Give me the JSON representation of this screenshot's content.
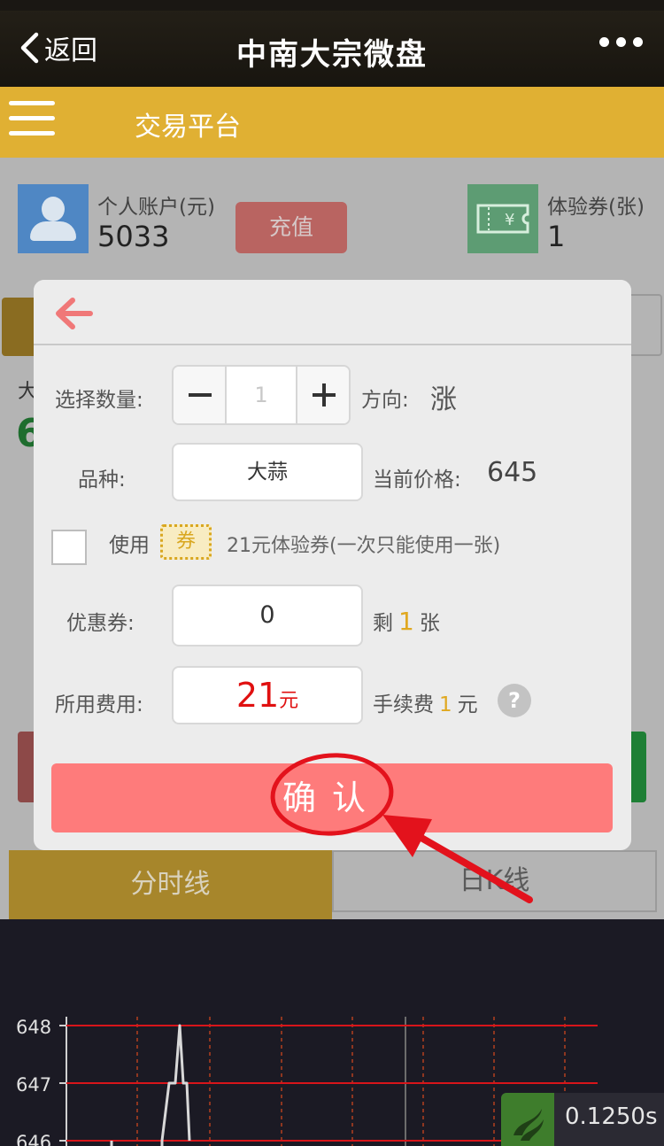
{
  "nav": {
    "back_label": "返回",
    "title": "中南大宗微盘"
  },
  "header": {
    "title": "交易平台"
  },
  "account": {
    "label": "个人账户(元)",
    "value": "5033",
    "recharge_label": "充值"
  },
  "coupons": {
    "label": "体验券(张)",
    "value": "1"
  },
  "background_fragments": {
    "char1": "大",
    "char2": "6"
  },
  "modal": {
    "quantity_label": "选择数量:",
    "quantity_value": "1",
    "direction_label": "方向:",
    "direction_value": "涨",
    "product_label": "品种:",
    "product_value": "大蒜",
    "price_label": "当前价格:",
    "price_value": "645",
    "use_label": "使用",
    "ticket_glyph": "券",
    "ticket_desc": "21元体验券(一次只能使用一张)",
    "coupon_label": "优惠券:",
    "coupon_value": "0",
    "remain_prefix": "剩",
    "remain_count": "1",
    "remain_suffix": "张",
    "fee_label": "所用费用:",
    "fee_amount": "21",
    "fee_unit": "元",
    "commission_label": "手续费",
    "commission_value": "1",
    "commission_unit": "元",
    "help_glyph": "?",
    "confirm_label": "确认"
  },
  "tabs": {
    "minute_line": "分时线",
    "daily_k": "日K线"
  },
  "chart_data": {
    "type": "line",
    "y_ticks": [
      "648",
      "647",
      "646"
    ],
    "ylim": [
      646,
      648
    ],
    "series": [
      {
        "values": [
          646,
          646,
          646,
          647,
          647,
          648,
          647,
          647,
          646
        ]
      }
    ],
    "grid": true
  },
  "timer": {
    "value": "0.1250s"
  },
  "colors": {
    "gold": "#e0b033",
    "confirm": "#fe7b7b",
    "fee_red": "#e01010",
    "annotation_red": "#e3121c"
  }
}
